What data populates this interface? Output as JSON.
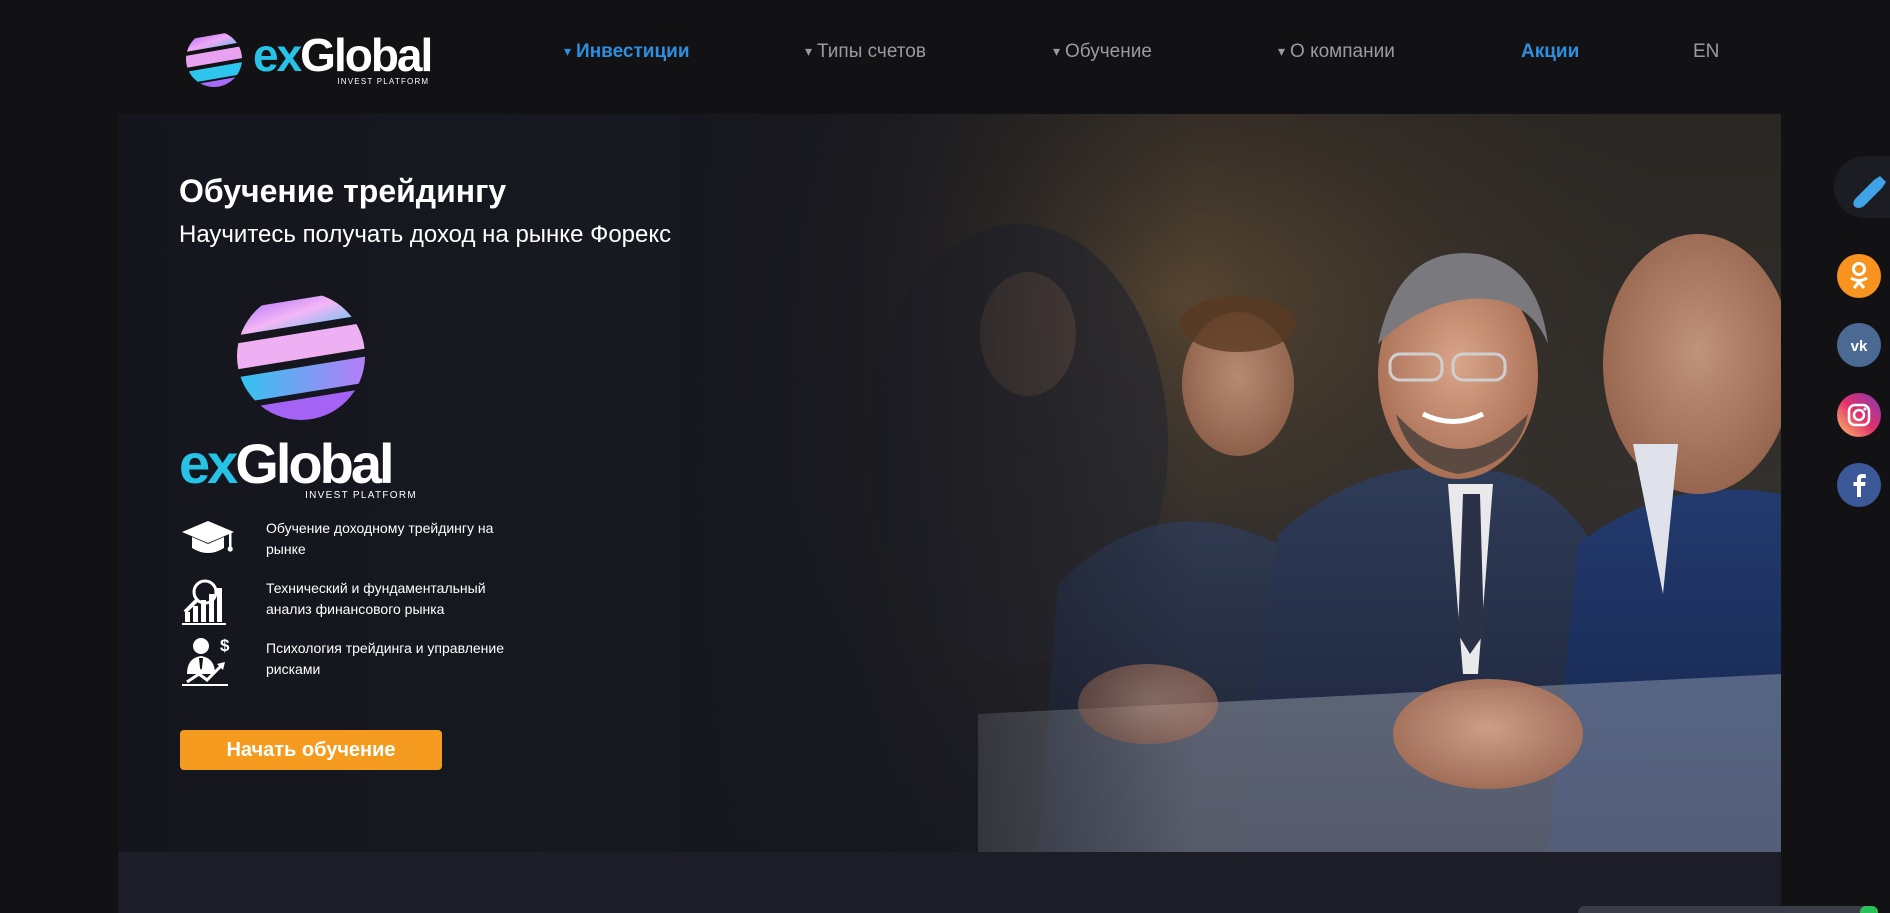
{
  "header": {
    "logo": {
      "word_ex": "ex",
      "word_global": "Global",
      "tagline": "INVEST PLATFORM"
    },
    "nav": [
      {
        "label": "Инвестиции",
        "has_arrow": true,
        "active": true
      },
      {
        "label": "Типы счетов",
        "has_arrow": true,
        "active": false
      },
      {
        "label": "Обучение",
        "has_arrow": true,
        "active": false
      },
      {
        "label": "О компании",
        "has_arrow": true,
        "active": false
      },
      {
        "label": "Акции",
        "has_arrow": false,
        "active": true
      },
      {
        "label": "EN",
        "has_arrow": false,
        "active": false
      }
    ],
    "arrow_glyph": "▾"
  },
  "hero": {
    "title": "Обучение трейдингу",
    "subtitle": "Научитесь получать доход на рынке Форекс",
    "logo": {
      "word_ex": "ex",
      "word_global": "Global",
      "tagline": "INVEST PLATFORM"
    },
    "features": [
      {
        "icon": "graduation-cap-icon",
        "text": "Обучение доходному трейдингу на рынке"
      },
      {
        "icon": "chart-analysis-icon",
        "text": "Технический и фундаментальный анализ финансового рынка"
      },
      {
        "icon": "trader-risk-icon",
        "text": "Психология трейдинга и управление рисками"
      }
    ],
    "cta_label": "Начать обучение"
  },
  "social": [
    {
      "name": "odnoklassniki",
      "icon": "odnoklassniki-icon",
      "color": "#f7931e"
    },
    {
      "name": "vk",
      "icon": "vk-icon",
      "color": "#4a6a94"
    },
    {
      "name": "instagram",
      "icon": "instagram-icon",
      "color": "#d6249f"
    },
    {
      "name": "facebook",
      "icon": "facebook-icon",
      "color": "#3b5998"
    }
  ],
  "colors": {
    "accent_blue": "#2e8fe0",
    "cta_orange": "#f59b1f",
    "brand_cyan": "#27c3e6",
    "background": "#121214"
  }
}
